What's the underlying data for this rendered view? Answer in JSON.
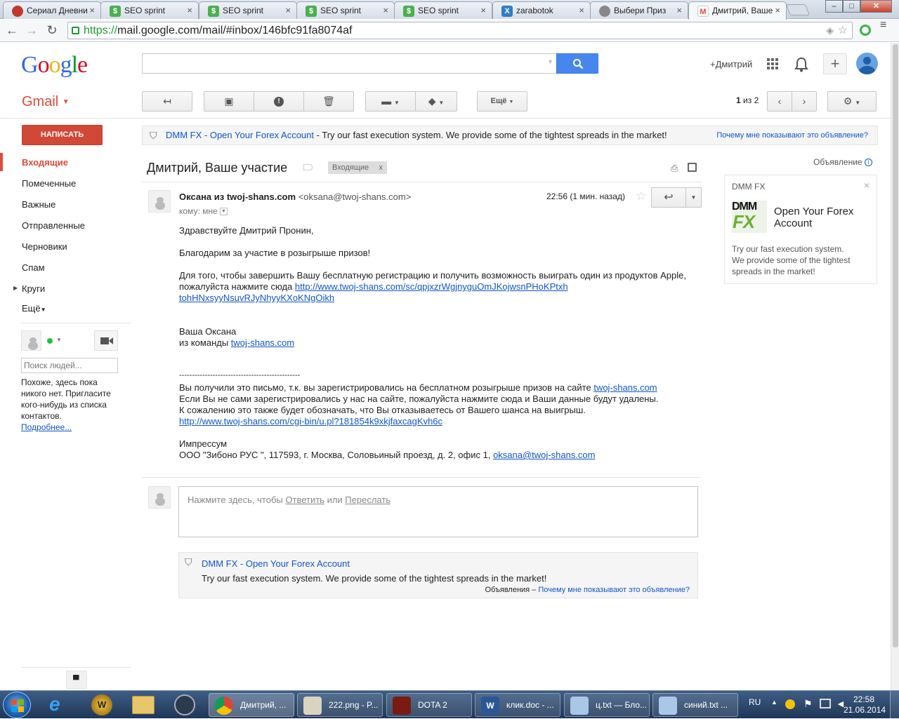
{
  "browser": {
    "tabs": [
      {
        "title": "Сериал Дневни",
        "fav": "",
        "color": "#c0392b"
      },
      {
        "title": "SEO sprint",
        "fav": "$",
        "color": "#4caf50"
      },
      {
        "title": "SEO sprint",
        "fav": "$",
        "color": "#4caf50"
      },
      {
        "title": "SEO sprint",
        "fav": "$",
        "color": "#4caf50"
      },
      {
        "title": "SEO sprint",
        "fav": "$",
        "color": "#4caf50"
      },
      {
        "title": "zarabotok",
        "fav": "X",
        "color": "#2a7fc9"
      },
      {
        "title": "Выбери Приз",
        "fav": "",
        "color": "#888"
      },
      {
        "title": "Дмитрий, Ваше",
        "fav": "M",
        "color": "#dd4b39"
      }
    ],
    "url_https": "https://",
    "url_rest": "mail.google.com/mail/#inbox/146bfc91fa8074af"
  },
  "header": {
    "logo": "Google",
    "user_link": "+Дмитрий"
  },
  "toolbar": {
    "gmail_label": "Gmail",
    "more_label": "Ещё",
    "pager": "1",
    "pager_of": "из 2"
  },
  "sidebar": {
    "compose": "НАПИСАТЬ",
    "items": [
      "Входящие",
      "Помеченные",
      "Важные",
      "Отправленные",
      "Черновики",
      "Спам",
      "Круги",
      "Ещё"
    ],
    "people_search_placeholder": "Поиск людей...",
    "empty_text": [
      "Похоже, здесь пока",
      "никого нет. Пригласите",
      "кого-нибудь из списка",
      "контактов."
    ],
    "more_link": "Подробнее..."
  },
  "ad_top": {
    "sponsor": "DMM FX",
    "title": "Open Your Forex Account",
    "text": " - Try our fast execution system. We provide some of the tightest spreads in the market!",
    "why": "Почему мне показывают это объявление?"
  },
  "thread": {
    "subject": "Дмитрий, Ваше участие",
    "label": "Входящие",
    "label_x": "x"
  },
  "message": {
    "sender_name": "Оксана из twoj-shans.com",
    "sender_email": "<oksana@twoj-shans.com>",
    "time": "22:56 (1 мин. назад)",
    "to": "кому: мне",
    "greeting": "Здравствуйте Дмитрий Пронин,",
    "thanks": "Благодарим за участие в розыгрыше призов!",
    "body1": "Для того, чтобы завершить Вашу бесплатную регистрацию и получить возможность выиграть один из продуктов Apple,",
    "body2": "пожалуйста нажмите сюда ",
    "link1a": "http://www.twoj-shans.com/sc/qpjxzrWgjnyguOmJKojwsnPHoKPtxh",
    "link1b": "tohHNxsyyNsuvRJyNhyyKXoKNgOikh",
    "sign1": "Ваша Оксана",
    "sign2": "из команды ",
    "sign_link": "twoj-shans.com",
    "divider": "-----------------------------------------------",
    "foot1": "Вы получили это письмо, т.к. вы зарегистрировались на бесплатном розыгрыше призов на сайте ",
    "foot1_link": "twoj-shans.com",
    "foot2": "Если Вы не сами зарегистрировались у нас на сайте, пожалуйста нажмите сюда и Ваши данные будут удалены.",
    "foot3": "К сожалению это также  будет обозначать, что Вы отказываетесь от Вашего шанса на выигрыш.",
    "foot_link": "http://www.twoj-shans.com/cgi-bin/u.pl?181854k9xkjfaxcagKvh6c",
    "imprint": "Импрессум",
    "address": "ООО \"Зибоно РУС \", 117593, г. Москва, Соловьиный проезд, д. 2, офис 1, ",
    "address_email": "oksana@twoj-shans.com"
  },
  "reply": {
    "prompt": "Нажмите здесь, чтобы ",
    "reply_link": "Ответить",
    "or": " или ",
    "forward_link": "Переслать"
  },
  "ad_bottom": {
    "sponsor": "DMM FX",
    "title": "Open Your Forex Account",
    "text": "Try our fast execution system. We provide some of the tightest spreads in the market!",
    "footer_prefix": "Объявления – ",
    "why": "Почему мне показывают это объявление?"
  },
  "side_ad": {
    "heading": "Объявление",
    "sponsor": "DMM FX",
    "logo_top": "DMM",
    "logo_bottom": "FX",
    "title1": "Open Your Forex",
    "title2": "Account",
    "text1": "Try our fast execution system.",
    "text2": "We provide some of the tightest",
    "text3": "spreads in the market!"
  },
  "taskbar": {
    "items": [
      "Дмитрий, ...",
      "222.png - P...",
      "DOTA 2",
      "клик.doc - ...",
      "ц.txt — Бло...",
      "синий.txt ..."
    ],
    "lang": "RU",
    "time": "22:58",
    "date": "21.06.2014"
  }
}
